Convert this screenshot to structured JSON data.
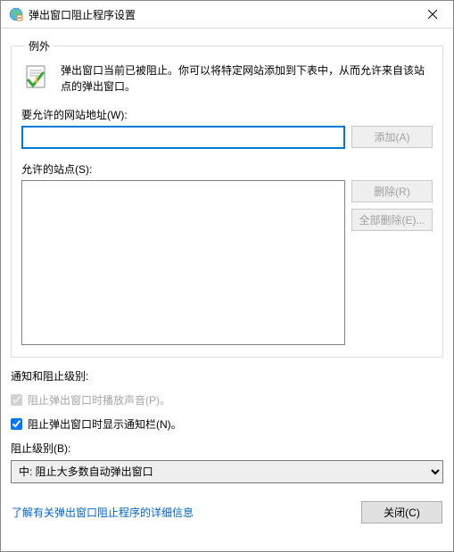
{
  "titlebar": {
    "title": "弹出窗口阻止程序设置"
  },
  "exceptions": {
    "legend": "例外",
    "intro": "弹出窗口当前已被阻止。你可以将特定网站添加到下表中，从而允许来自该站点的弹出窗口。",
    "address_label": "要允许的网站地址(W):",
    "address_value": "",
    "add_btn": "添加(A)",
    "allowed_label": "允许的站点(S):",
    "remove_btn": "删除(R)",
    "remove_all_btn": "全部删除(E)..."
  },
  "notify": {
    "heading": "通知和阻止级别:",
    "sound_label": "阻止弹出窗口时播放声音(P)。",
    "sound_checked": true,
    "bar_label": "阻止弹出窗口时显示通知栏(N)。",
    "bar_checked": true,
    "level_label": "阻止级别(B):",
    "level_selected": "中: 阻止大多数自动弹出窗口"
  },
  "footer": {
    "learn_more": "了解有关弹出窗口阻止程序的详细信息",
    "close_btn": "关闭(C)"
  }
}
